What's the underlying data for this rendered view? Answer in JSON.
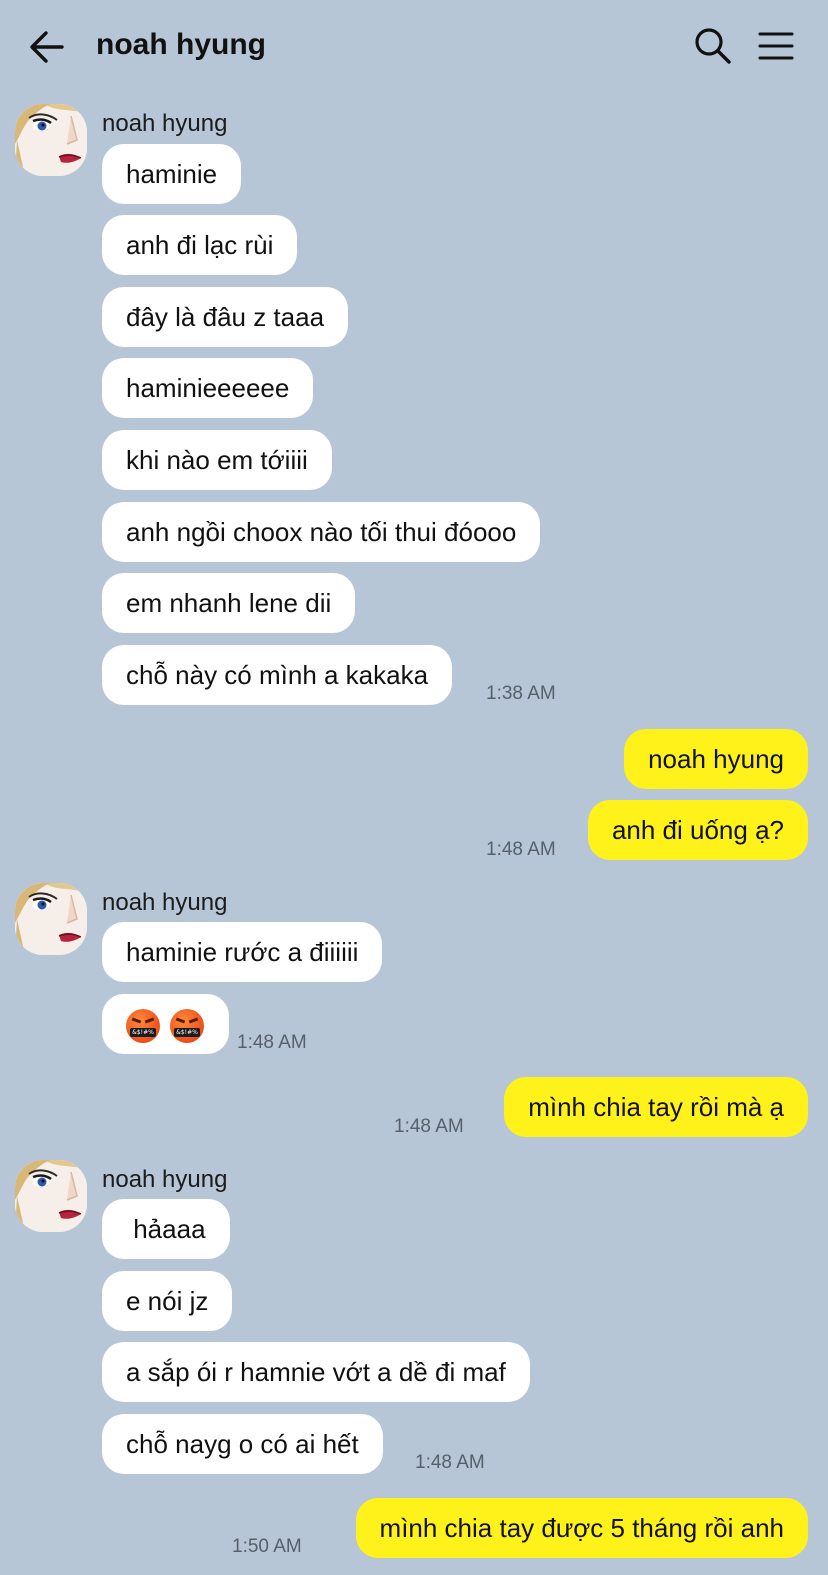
{
  "header": {
    "title": "noah hyung"
  },
  "messages": {
    "g1": {
      "sender": "noah hyung",
      "m1": "haminie",
      "m2": "anh đi lạc rùi",
      "m3": "đây là đâu z taaa",
      "m4": "haminieeeeee",
      "m5": "khi nào em tớiiii",
      "m6": "anh ngồi choox nào tối thui đóooo",
      "m7": "em nhanh lene dii",
      "m8": "chỗ này có mình a kakaka",
      "time": "1:38 AM"
    },
    "o1": {
      "m1": "noah hyung",
      "m2": "anh đi uống ạ?",
      "time": "1:48 AM"
    },
    "g2": {
      "sender": "noah hyung",
      "m1": "haminie rước a điiiiii",
      "emoji": "🤬🤬",
      "time": "1:48 AM"
    },
    "o2": {
      "m1": "mình chia tay rồi mà ạ",
      "time": "1:48 AM"
    },
    "g3": {
      "sender": "noah hyung",
      "m1": " hảaaa",
      "m2": "e nói jz",
      "m3": "a sắp ói r hamnie vớt a dề đi maf",
      "m4": "chỗ nayg o có ai hết",
      "time": "1:48 AM"
    },
    "o3": {
      "m1": "mình chia tay được 5 tháng rồi anh",
      "time": "1:50 AM"
    }
  },
  "icons": [
    "back-arrow-icon",
    "search-icon",
    "menu-icon",
    "avatar-image",
    "enraged-face-emoji"
  ],
  "colors": {
    "background": "#b7c6d7",
    "incoming": "#ffffff",
    "outgoing": "#fff21a"
  }
}
